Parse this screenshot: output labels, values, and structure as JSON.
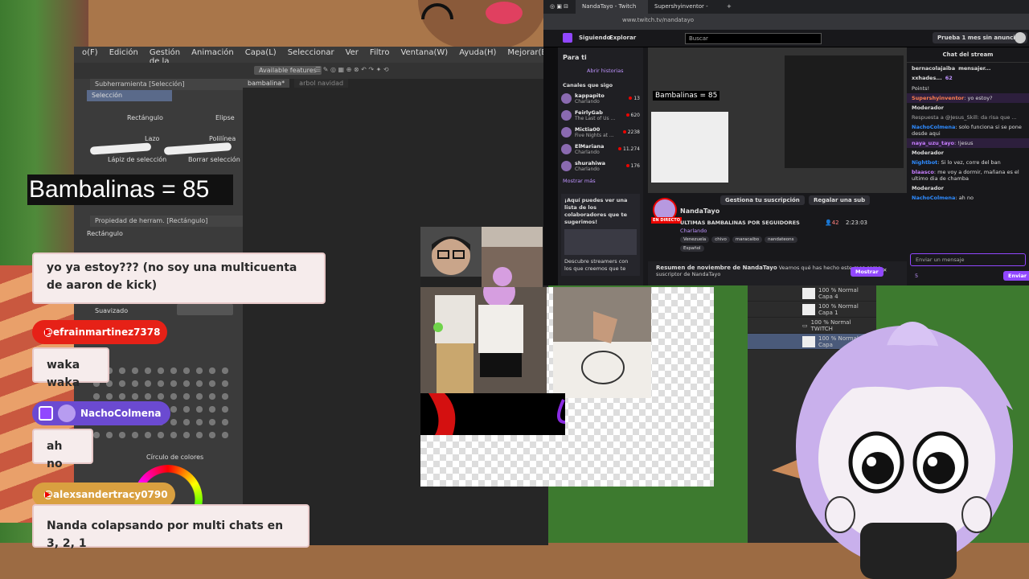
{
  "clip_studio": {
    "menu": [
      "o(F)",
      "Edición",
      "Gestión de la página",
      "Animación",
      "Capa(L)",
      "Seleccionar",
      "Ver",
      "Filtro",
      "Ventana(W)",
      "Ayuda(H)",
      "Mejorar(B)"
    ],
    "toolbar_feature": "Available features",
    "tabs": [
      "bambalina*",
      "arbol navidad"
    ],
    "subtool_title": "Subherramienta [Selección]",
    "subtool_tab": "Selección",
    "tools": [
      "Rectángulo",
      "Elipse",
      "Lazo",
      "Polilínea",
      "Lápiz de selección",
      "Borrar selección"
    ],
    "tool_property_title": "Propiedad de herram. [Rectángulo]",
    "tool_property_value": "Rectángulo",
    "smoothing_label": "Suavizado",
    "color_wheel_label": "Círculo de colores"
  },
  "overlay": {
    "bambalinas_text": "Bambalinas = 85"
  },
  "chat_overlay": [
    {
      "user": "",
      "message": "yo ya estoy??? (no soy una multicuenta de aaron de kick)",
      "platform": "youtube"
    },
    {
      "user": "@efrainmartinez7378",
      "message": "waka waka",
      "platform": "youtube"
    },
    {
      "user": "NachoColmena",
      "message": "ah no",
      "platform": "twitch"
    },
    {
      "user": "@alexsandertracy0790",
      "message": "Nanda colapsando por multi chats en 3, 2, 1",
      "platform": "youtube"
    }
  ],
  "browser": {
    "tabs": [
      "NandaTayo - Twitch",
      "Supershyinventor - Twitch"
    ],
    "url": "www.twitch.tv/nandatayo",
    "nav_following": "Siguiendo",
    "nav_explore": "Explorar",
    "search_placeholder": "Buscar",
    "prime_label": "Prueba 1 mes sin anuncios",
    "sidebar_title": "Para ti",
    "stories": "Abrir historias",
    "followed_title": "Canales que sigo",
    "channels": [
      {
        "name": "kappapito",
        "game": "Charlando",
        "viewers": "13"
      },
      {
        "name": "FeirlyGab",
        "game": "The Last of Us ...",
        "viewers": "620"
      },
      {
        "name": "Mictia00",
        "game": "Five Nights at ...",
        "viewers": "2238"
      },
      {
        "name": "ElMariana",
        "game": "Charlando",
        "viewers": "11.274"
      },
      {
        "name": "shurahiwa",
        "game": "Charlando",
        "viewers": "176"
      }
    ],
    "show_more": "Mostrar más",
    "promo_text": "¡Aquí puedes ver una lista de los colaboradores que te sugerimos!",
    "promo_sub": "Descubre streamers con los que creemos que te",
    "stream_overlay_text": "Bambalinas = 85",
    "streamer": "NandaTayo",
    "live_label": "EN DIRECTO",
    "stream_title": "ULTIMAS BAMBALINAS POR SEGUIDORES",
    "stream_category": "Charlando",
    "stream_tags": [
      "Venezuela",
      "chivo",
      "maracaibo",
      "nandateons",
      "Español"
    ],
    "viewers": "42",
    "uptime": "2:23:03",
    "sub_manage": "Gestiona tu suscripción",
    "gift_sub": "Regalar una sub",
    "recap_title": "Resumen de noviembre de NandaTayo",
    "recap_text": "Veamos qué has hecho este mes como suscriptor de NandaTayo",
    "recap_button": "Mostrar",
    "chat_title": "Chat del stream",
    "chat_top_user": "bernacolajaiba",
    "chat_top_user_2": "mensajer...",
    "chat_top_user_3": "xxhades...",
    "chat_top_points": "62",
    "chat_points_label": "Points!",
    "chat": [
      {
        "user": "Supershyinventor",
        "text": "yo estoy?",
        "color": "#ff7f50"
      },
      {
        "user": "Moderador",
        "text": "",
        "color": "#dddddd"
      },
      {
        "user": "",
        "text": "Respuesta a @Jesus_Skill: da risa que ...",
        "color": "#aaaaaa"
      },
      {
        "user": "NachoColmena",
        "text": "solo funciona si se pone desde aqui",
        "color": "#2e8bff"
      },
      {
        "user": "naya_uzu_tayo",
        "text": "!jesus",
        "color": "#c77dff"
      },
      {
        "user": "Moderador",
        "text": "",
        "color": "#dddddd"
      },
      {
        "user": "Nightbot",
        "text": "Si lo vez, corre del ban",
        "color": "#2e8bff"
      },
      {
        "user": "blaasco",
        "text": "me voy a dormir, mañana es el ultimo dia de chamba",
        "color": "#c77dff"
      },
      {
        "user": "Moderador",
        "text": "",
        "color": "#dddddd"
      },
      {
        "user": "NachoColmena",
        "text": "ah no",
        "color": "#2e8bff"
      }
    ],
    "chat_input_placeholder": "Enviar un mensaje",
    "send_button": "Enviar",
    "chat_balance": "5"
  },
  "layers": [
    {
      "blend": "100 % Normal",
      "name": "Capa 4"
    },
    {
      "blend": "100 % Normal",
      "name": "Capa 1"
    },
    {
      "blend": "100 % Normal",
      "name": "TWITCH"
    },
    {
      "blend": "100 % Normal",
      "name": "Capa"
    }
  ],
  "colors": {
    "twitch_purple": "#9147ff",
    "live_red": "#eb0400",
    "youtube_red": "#e62117",
    "bubble_bg": "#f6ecec"
  }
}
